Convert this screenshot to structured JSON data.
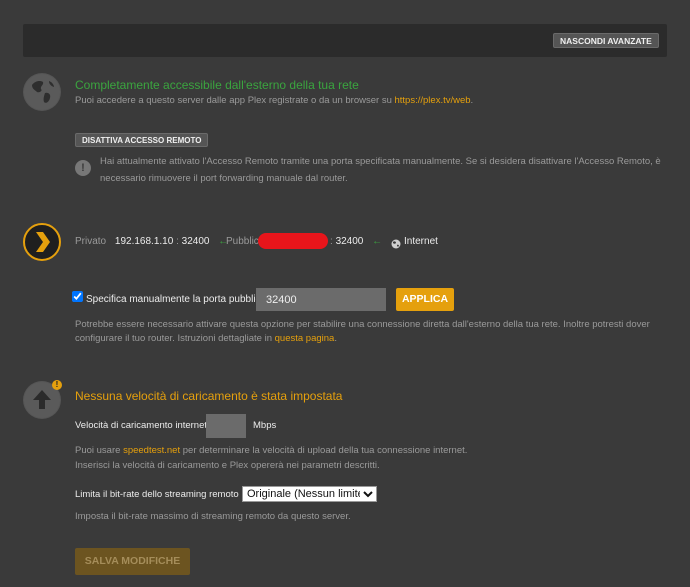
{
  "header": {
    "hide_advanced_label": "NASCONDI AVANZATE"
  },
  "remote": {
    "status_title": "Completamente accessibile dall'esterno della tua rete",
    "status_desc_prefix": "Puoi accedere a questo server dalle app Plex registrate o da un browser su ",
    "status_link": "https://plex.tv/web",
    "status_desc_suffix": ".",
    "disable_button": "DISATTIVA ACCESSO REMOTO",
    "warning_line1": "Hai attualmente attivato l'Accesso Remoto tramite una porta specificata manualmente. Se si desidera disattivare l'Accesso Remoto, è",
    "warning_line2": "necessario rimuovere il port forwarding manuale dal router."
  },
  "network": {
    "private_label": "Privato",
    "private_ip": "192.168.1.10",
    "sep": ":",
    "private_port": "32400",
    "public_label": "Pubblico",
    "public_port": "32400",
    "internet_label": "Internet",
    "arrow": "←"
  },
  "port": {
    "checkbox_label": "Specifica manualmente la porta pubblica",
    "checked": true,
    "value": "32400",
    "apply_label": "APPLICA",
    "help_line1": "Potrebbe essere necessario attivare questa opzione per stabilire una connessione diretta dall'esterno della tua rete. Inoltre potresti dover",
    "help_line2_prefix": "configurare il tuo router. Istruzioni dettagliate in ",
    "help_link": "questa pagina",
    "help_line2_suffix": "."
  },
  "upload": {
    "title": "Nessuna velocità di caricamento è stata impostata",
    "speed_label": "Velocità di caricamento internet",
    "speed_value": "",
    "unit": "Mbps",
    "help1_prefix": "Puoi usare ",
    "help1_link": "speedtest.net",
    "help1_suffix": " per determinare la velocità di upload della tua connessione internet.",
    "help2": "Inserisci la velocità di caricamento e Plex opererà nei parametri descritti.",
    "limit_label": "Limita il bit-rate dello streaming remoto",
    "limit_selected": "Originale (Nessun limite)",
    "limit_help": "Imposta il bit-rate massimo di streaming remoto da questo server.",
    "save_label": "SALVA MODIFICHE",
    "badge": "!"
  },
  "colors": {
    "accent": "#e5a00d",
    "success": "#3aa53f",
    "background": "#3a3a3a"
  },
  "icons": [
    "globe-icon",
    "warning-icon",
    "plex-chevron-icon",
    "upload-arrow-icon",
    "internet-globe-icon"
  ]
}
